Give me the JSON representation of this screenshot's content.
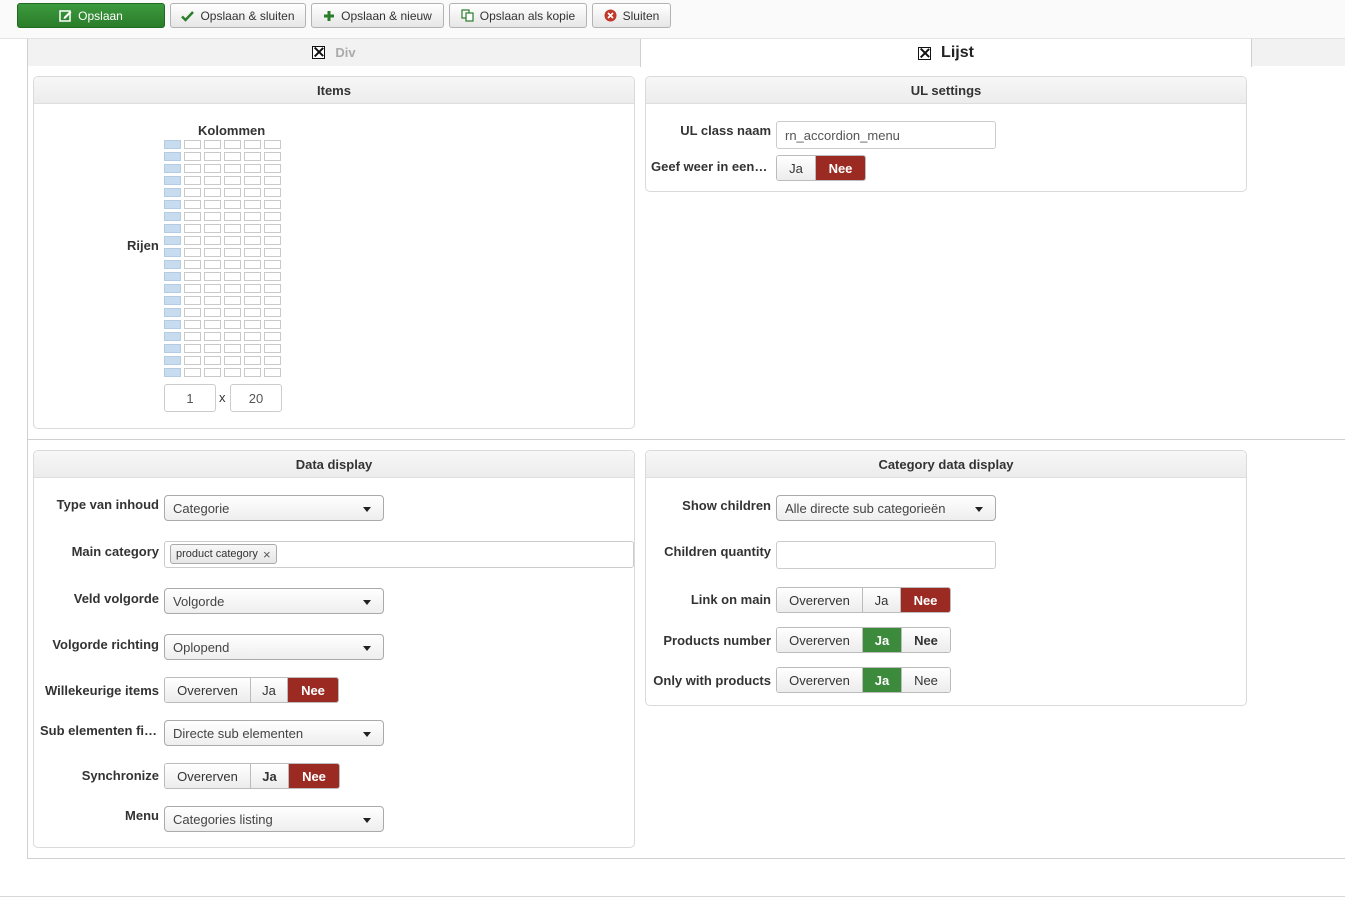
{
  "toolbar": {
    "save": "Opslaan",
    "save_close": "Opslaan & sluiten",
    "save_new": "Opslaan & nieuw",
    "save_copy": "Opslaan als kopie",
    "close": "Sluiten"
  },
  "tabs": [
    {
      "label": "Div",
      "active": false
    },
    {
      "label": "Lijst",
      "active": true
    }
  ],
  "items_panel": {
    "title": "Items",
    "columns_label": "Kolommen",
    "rows_label": "Rijen",
    "columns_value": "1",
    "times": "x",
    "rows_value": "20",
    "grid_total_columns": 6,
    "grid_total_rows": 20
  },
  "ul_panel": {
    "title": "UL settings",
    "class_label": "UL class naam",
    "class_value": "rn_accordion_menu",
    "show_label": "Geef weer in een…",
    "show_options": [
      "Ja",
      "Nee"
    ],
    "show_selected": "Nee"
  },
  "data_panel": {
    "title": "Data display",
    "type_label": "Type van inhoud",
    "type_value": "Categorie",
    "main_cat_label": "Main category",
    "main_cat_tag": "product category",
    "field_order_label": "Veld volgorde",
    "field_order_value": "Volgorde",
    "order_dir_label": "Volgorde richting",
    "order_dir_value": "Oplopend",
    "random_label": "Willekeurige items",
    "random_options": [
      "Overerven",
      "Ja",
      "Nee"
    ],
    "random_selected": "Nee",
    "sub_label": "Sub elementen fi…",
    "sub_value": "Directe sub elementen",
    "sync_label": "Synchronize",
    "sync_options": [
      "Overerven",
      "Ja",
      "Nee"
    ],
    "sync_selected": "Nee",
    "menu_label": "Menu",
    "menu_value": "Categories listing"
  },
  "cat_panel": {
    "title": "Category data display",
    "children_label": "Show children",
    "children_value": "Alle directe sub categorieën",
    "qty_label": "Children quantity",
    "qty_value": "",
    "link_label": "Link on main",
    "link_options": [
      "Overerven",
      "Ja",
      "Nee"
    ],
    "link_selected": "Nee",
    "prod_num_label": "Products number",
    "prod_num_options": [
      "Overerven",
      "Ja",
      "Nee"
    ],
    "prod_num_selected": "Ja",
    "only_label": "Only with products",
    "only_options": [
      "Overerven",
      "Ja",
      "Nee"
    ],
    "only_selected": "Ja"
  },
  "colors": {
    "primary_green": "#2f8a2f",
    "selected_red": "#9b2b22",
    "selected_green": "#3c8a3c",
    "grid_selected": "#c8dcf0"
  }
}
